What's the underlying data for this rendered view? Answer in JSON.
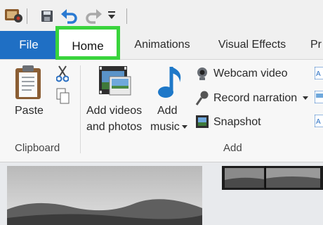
{
  "quick_access": {
    "icons": [
      "app-icon",
      "save-icon",
      "undo-icon",
      "redo-icon",
      "customize-icon"
    ]
  },
  "tabs": {
    "file": "File",
    "home": "Home",
    "animations": "Animations",
    "visual_effects": "Visual Effects",
    "partial": "Pr"
  },
  "ribbon": {
    "clipboard": {
      "paste": "Paste",
      "group": "Clipboard"
    },
    "add": {
      "add_videos_line1": "Add videos",
      "add_videos_line2": "and photos",
      "add_music_line1": "Add",
      "add_music_line2": "music",
      "webcam": "Webcam video",
      "narration": "Record narration",
      "snapshot": "Snapshot",
      "group": "Add"
    }
  },
  "colors": {
    "file_tab": "#1f6fc4",
    "home_highlight": "#39d43c",
    "undo_blue": "#2a7ad2"
  }
}
